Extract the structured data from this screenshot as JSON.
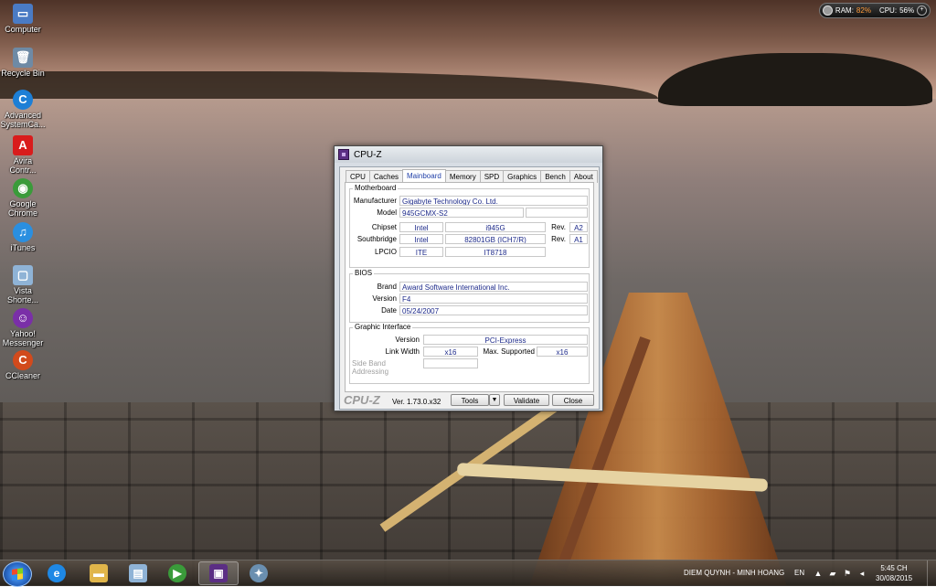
{
  "desktop_icons": [
    {
      "label": "Computer",
      "glyph": "▭",
      "color": "#4a7bc4"
    },
    {
      "label": "Recycle Bin",
      "glyph": "🗑",
      "color": "#6e8aa5"
    },
    {
      "label": "Advanced SystemCa...",
      "glyph": "C",
      "color": "#1d7fd6"
    },
    {
      "label": "Avira Contr...",
      "glyph": "A",
      "color": "#d91c1c"
    },
    {
      "label": "Google Chrome",
      "glyph": "◉",
      "color": "#3a9b3a"
    },
    {
      "label": "iTunes",
      "glyph": "♫",
      "color": "#2a8fe0"
    },
    {
      "label": "Vista Shorte...",
      "glyph": "▢",
      "color": "#8fb3d6"
    },
    {
      "label": "Yahoo! Messenger",
      "glyph": "☺",
      "color": "#7a2fa8"
    },
    {
      "label": "CCleaner",
      "glyph": "C",
      "color": "#d24a1c"
    }
  ],
  "gadget": {
    "ram_label": "RAM:",
    "ram_value": "82%",
    "cpu_label": "CPU:",
    "cpu_value": "56%"
  },
  "window": {
    "title": "CPU-Z",
    "tabs": [
      "CPU",
      "Caches",
      "Mainboard",
      "Memory",
      "SPD",
      "Graphics",
      "Bench",
      "About"
    ],
    "active_tab": "Mainboard",
    "motherboard": {
      "group_title": "Motherboard",
      "manufacturer_label": "Manufacturer",
      "manufacturer": "Gigabyte Technology Co. Ltd.",
      "model_label": "Model",
      "model": "945GCMX-S2",
      "model_extra": "",
      "chipset_label": "Chipset",
      "chipset_vendor": "Intel",
      "chipset_model": "i945G",
      "chipset_rev_label": "Rev.",
      "chipset_rev": "A2",
      "southbridge_label": "Southbridge",
      "southbridge_vendor": "Intel",
      "southbridge_model": "82801GB (ICH7/R)",
      "southbridge_rev_label": "Rev.",
      "southbridge_rev": "A1",
      "lpcio_label": "LPCIO",
      "lpcio_vendor": "ITE",
      "lpcio_model": "IT8718"
    },
    "bios": {
      "group_title": "BIOS",
      "brand_label": "Brand",
      "brand": "Award Software International Inc.",
      "version_label": "Version",
      "version": "F4",
      "date_label": "Date",
      "date": "05/24/2007"
    },
    "graphic_interface": {
      "group_title": "Graphic Interface",
      "version_label": "Version",
      "version": "PCI-Express",
      "link_width_label": "Link Width",
      "link_width": "x16",
      "max_supported_label": "Max. Supported",
      "max_supported": "x16",
      "sideband_label": "Side Band Addressing",
      "sideband": ""
    },
    "bottom": {
      "brand": "CPU-Z",
      "version": "Ver. 1.73.0.x32",
      "tools_label": "Tools",
      "validate_label": "Validate",
      "close_label": "Close"
    }
  },
  "taskbar": {
    "apps": [
      {
        "name": "Internet Explorer",
        "glyph": "e",
        "color": "#1e88e5"
      },
      {
        "name": "Windows Explorer",
        "glyph": "▬",
        "color": "#e0b54a"
      },
      {
        "name": "Notepad",
        "glyph": "▤",
        "color": "#8fb3d6"
      },
      {
        "name": "Windows Media Player",
        "glyph": "▶",
        "color": "#3a9b3a"
      },
      {
        "name": "CPU-Z",
        "glyph": "▣",
        "color": "#5b2e84"
      },
      {
        "name": "Unknown app",
        "glyph": "✦",
        "color": "#6a8fb0"
      }
    ],
    "notification_text": "DIEM QUYNH - MINH HOANG",
    "language": "EN",
    "time": "5:45 CH",
    "date": "30/08/2015"
  }
}
